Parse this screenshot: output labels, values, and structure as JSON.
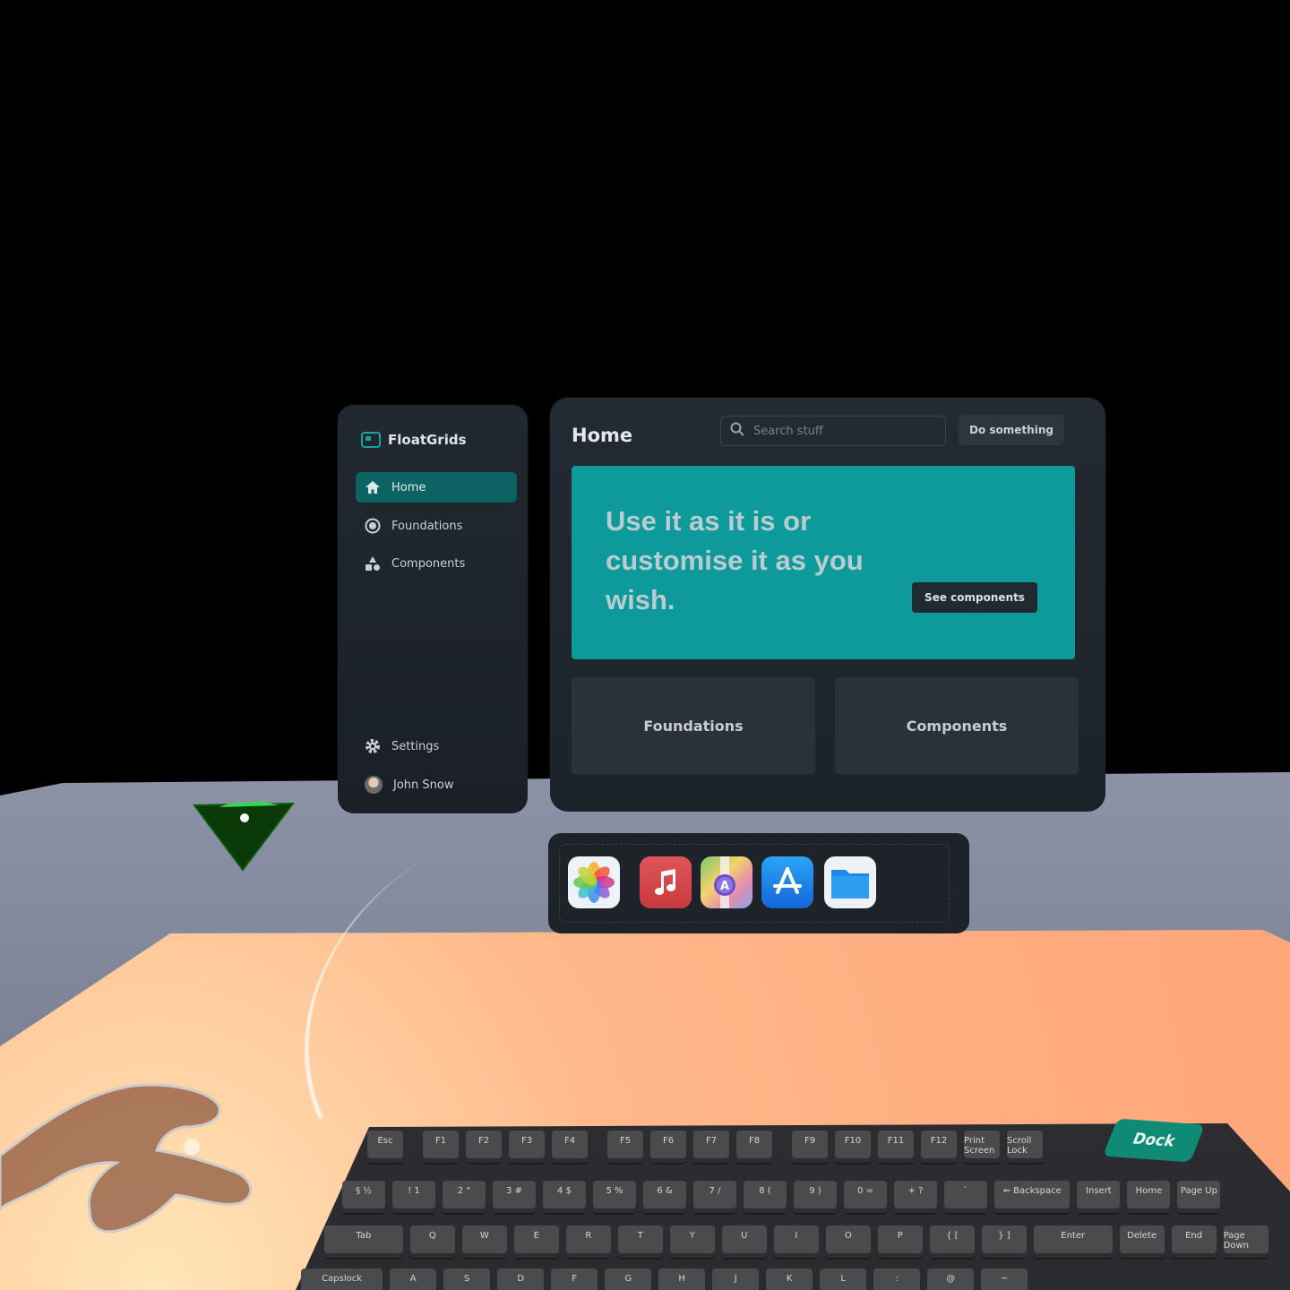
{
  "sidebar": {
    "brand": "FloatGrids",
    "items": [
      {
        "label": "Home",
        "icon": "home-icon",
        "active": true
      },
      {
        "label": "Foundations",
        "icon": "target-icon",
        "active": false
      },
      {
        "label": "Components",
        "icon": "shapes-icon",
        "active": false
      }
    ],
    "settings_label": "Settings",
    "user_name": "John Snow"
  },
  "main": {
    "title": "Home",
    "search_placeholder": "Search stuff",
    "action_label": "Do something",
    "hero": {
      "text": "Use it as it is or customise it as you wish.",
      "button_label": "See components"
    },
    "cards": [
      {
        "label": "Foundations"
      },
      {
        "label": "Components"
      }
    ]
  },
  "dock": {
    "apps": [
      {
        "name": "photos-icon"
      },
      {
        "name": "music-icon"
      },
      {
        "name": "maps-icon"
      },
      {
        "name": "app-store-icon"
      },
      {
        "name": "files-icon"
      }
    ]
  },
  "keyboard": {
    "function_row": [
      "Esc",
      "F1",
      "F2",
      "F3",
      "F4",
      "F5",
      "F6",
      "F7",
      "F8",
      "F9",
      "F10",
      "F11",
      "F12",
      "Print Screen",
      "Scroll Lock"
    ],
    "number_row": [
      "§ ½",
      "! 1",
      "2 \"",
      "3 #",
      "4 $",
      "5 %",
      "6 &",
      "7 /",
      "8 (",
      "9 )",
      "0 =",
      "+ ?",
      "`",
      "⇐ Backspace",
      "Insert",
      "Home",
      "Page Up"
    ],
    "top_row": [
      "Tab",
      "Q",
      "W",
      "E",
      "R",
      "T",
      "Y",
      "U",
      "I",
      "O",
      "P",
      "{ [",
      "} ]",
      "Enter",
      "Delete",
      "End",
      "Page Down"
    ],
    "home_row": [
      "Capslock",
      "A",
      "S",
      "D",
      "F",
      "G",
      "H",
      "J",
      "K",
      "L",
      ":",
      "@",
      "~"
    ],
    "dock_toggle_label": "Dock"
  },
  "colors": {
    "accent": "#0e9a9b",
    "active_nav": "#0d6363",
    "panel": "#1f252d",
    "desk": "#ffaa7e",
    "dock_toggle": "#0e8a75"
  }
}
